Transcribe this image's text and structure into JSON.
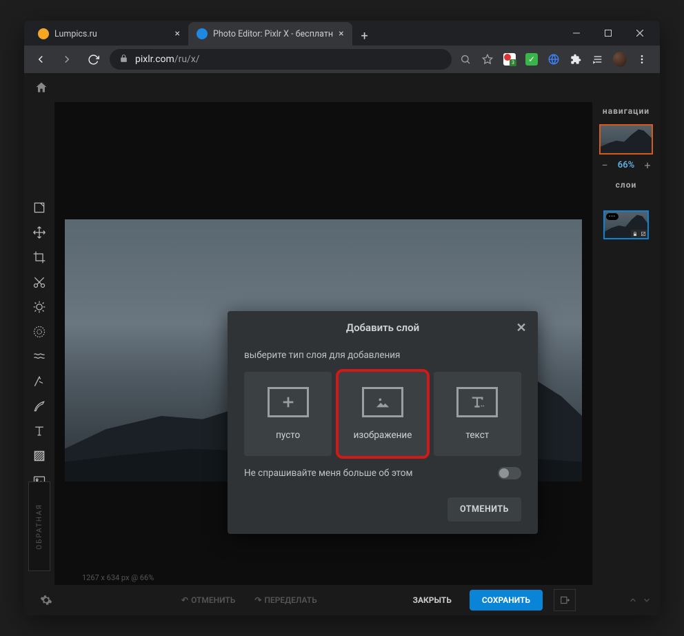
{
  "tabs": [
    {
      "title": "Lumpics.ru",
      "active": false,
      "favicon_color": "#f5a623"
    },
    {
      "title": "Photo Editor: Pixlr X - бесплатн",
      "active": true,
      "favicon_color": "#1e88e5"
    }
  ],
  "url": {
    "domain": "pixlr.com",
    "path": "/ru/x/"
  },
  "right_panel": {
    "nav_header": "навигации",
    "zoom": "66%",
    "layers_header": "слои"
  },
  "canvas_status": "1267 x 634 px @ 66%",
  "bottom": {
    "undo": "ОТМЕНИТЬ",
    "redo": "ПЕРЕДЕЛАТЬ",
    "close": "ЗАКРЫТЬ",
    "save": "СОХРАНИТЬ"
  },
  "feedback": "ОБРАТНАЯ",
  "modal": {
    "title": "Добавить слой",
    "subtitle": "выберите тип слоя для добавления",
    "options": {
      "empty": "пусто",
      "image": "изображение",
      "text": "текст"
    },
    "dont_ask": "Не спрашивайте меня больше об этом",
    "cancel": "ОТМЕНИТЬ"
  }
}
